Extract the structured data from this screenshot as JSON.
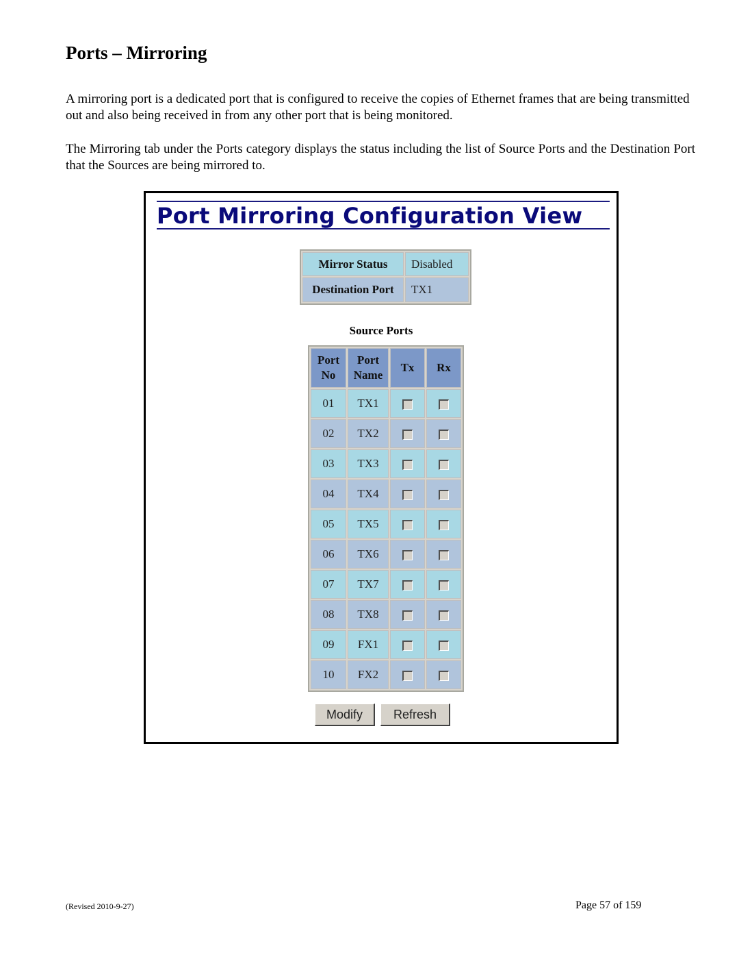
{
  "document": {
    "heading": "Ports – Mirroring",
    "paragraphs": [
      "A mirroring port is a dedicated port that is configured to receive the copies of Ethernet frames that are being transmitted out and also being received in from any other port that is being monitored.",
      "The Mirroring tab under the Ports category displays the status including the list of Source Ports and the Destination Port that the Sources are being mirrored to."
    ],
    "footer": {
      "revised": "(Revised 2010-9-27)",
      "page": "Page 57 of 159"
    }
  },
  "screenshot": {
    "title": "Port Mirroring Configuration View",
    "status": {
      "mirror_status_label": "Mirror Status",
      "mirror_status_value": "Disabled",
      "destination_port_label": "Destination Port",
      "destination_port_value": "TX1"
    },
    "source_ports_caption": "Source Ports",
    "columns": {
      "port_no": [
        "Port",
        "No"
      ],
      "port_name": [
        "Port",
        "Name"
      ],
      "tx": "Tx",
      "rx": "Rx"
    },
    "rows": [
      {
        "no": "01",
        "name": "TX1",
        "tx": false,
        "rx": false
      },
      {
        "no": "02",
        "name": "TX2",
        "tx": false,
        "rx": false
      },
      {
        "no": "03",
        "name": "TX3",
        "tx": false,
        "rx": false
      },
      {
        "no": "04",
        "name": "TX4",
        "tx": false,
        "rx": false
      },
      {
        "no": "05",
        "name": "TX5",
        "tx": false,
        "rx": false
      },
      {
        "no": "06",
        "name": "TX6",
        "tx": false,
        "rx": false
      },
      {
        "no": "07",
        "name": "TX7",
        "tx": false,
        "rx": false
      },
      {
        "no": "08",
        "name": "TX8",
        "tx": false,
        "rx": false
      },
      {
        "no": "09",
        "name": "FX1",
        "tx": false,
        "rx": false
      },
      {
        "no": "10",
        "name": "FX2",
        "tx": false,
        "rx": false
      }
    ],
    "buttons": {
      "modify": "Modify",
      "refresh": "Refresh"
    },
    "colors": {
      "title": "#0a0a7a",
      "header_bg": "#7c98c8",
      "row_light": "#a8d8e4",
      "row_dark": "#b0c4dc"
    }
  }
}
